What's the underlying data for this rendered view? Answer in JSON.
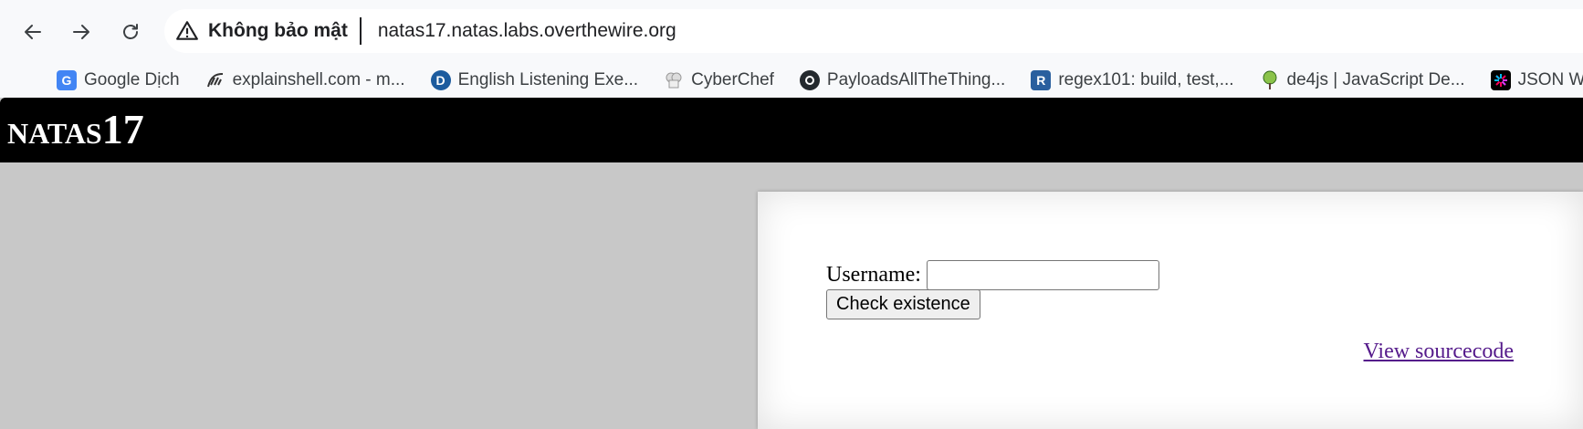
{
  "browser": {
    "security_label": "Không bảo mật",
    "url": "natas17.natas.labs.overthewire.org",
    "nav": {
      "back_icon": "arrow-left-icon",
      "forward_icon": "arrow-right-icon",
      "reload_icon": "reload-icon"
    },
    "bookmarks": [
      {
        "label": "Google Dịch",
        "icon": "google-translate-icon"
      },
      {
        "label": "explainshell.com - m...",
        "icon": "explainshell-icon"
      },
      {
        "label": "English Listening Exe...",
        "icon": "letter-d-icon"
      },
      {
        "label": "CyberChef",
        "icon": "chef-hat-icon"
      },
      {
        "label": "PayloadsAllTheThing...",
        "icon": "github-icon"
      },
      {
        "label": "regex101: build, test,...",
        "icon": "letter-r-icon"
      },
      {
        "label": "de4js | JavaScript De...",
        "icon": "de4js-icon"
      },
      {
        "label": "JSON Web Tokens - j...",
        "icon": "jwt-icon"
      }
    ]
  },
  "page": {
    "title": "natas17",
    "form": {
      "username_label": "Username:",
      "username_value": "",
      "submit_label": "Check existence"
    },
    "view_source_label": "View sourcecode"
  }
}
